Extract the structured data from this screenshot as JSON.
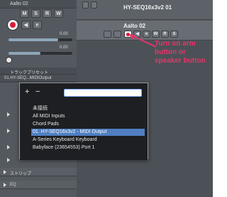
{
  "inspector": {
    "header_text": "Aalto 02",
    "mute_label": "M",
    "solo_label": "S",
    "read_label": "R",
    "write_label": "W",
    "volume_value": "0.00",
    "pan_value": "0.00",
    "insert_label": "トラックプリセット",
    "routing_value": "01.HY-SEQ...MIDIOutput",
    "section_strip": "ストリップ",
    "section_eq": "EQ"
  },
  "tracks": [
    {
      "name": "HY-SEQ16x3v2 01"
    },
    {
      "name": "Aalto 02"
    }
  ],
  "track_buttons": {
    "mute": "M",
    "solo": "S",
    "read": "R",
    "write": "W"
  },
  "annotation": {
    "text": "Turn on arm button or speaker button",
    "color": "#e8336a"
  },
  "popup": {
    "add_label": "+",
    "remove_label": "−",
    "search_value": "",
    "options": [
      "未接続",
      "All MIDI Inputs",
      "Chord Pads",
      "01. HY-SEQ16x3v2 - MIDI Output",
      "A-Series Keyboard Keyboard",
      "Babyface (23654553) Port 1"
    ],
    "selected_index": 3
  },
  "colors": {
    "arm_red": "#d81b3b",
    "selection_blue": "#4f7fc0"
  }
}
